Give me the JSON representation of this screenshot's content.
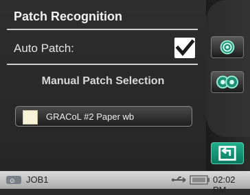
{
  "panel": {
    "title": "Patch Recognition",
    "auto_patch_label": "Auto Patch:",
    "auto_patch_checked": true,
    "manual_selection_title": "Manual Patch Selection",
    "selected_patch_label": "GRACoL #2 Paper wb"
  },
  "side_buttons": [
    {
      "icon": "target-icon"
    },
    {
      "icon": "double-target-icon"
    },
    {
      "icon": "back-icon"
    }
  ],
  "status_bar": {
    "job_label": "JOB1",
    "time": "02:02 PM"
  },
  "colors": {
    "accent_teal": "#1fae8a",
    "swatch": "#f7f3d8",
    "panel_bg": "#2b2b2b"
  }
}
